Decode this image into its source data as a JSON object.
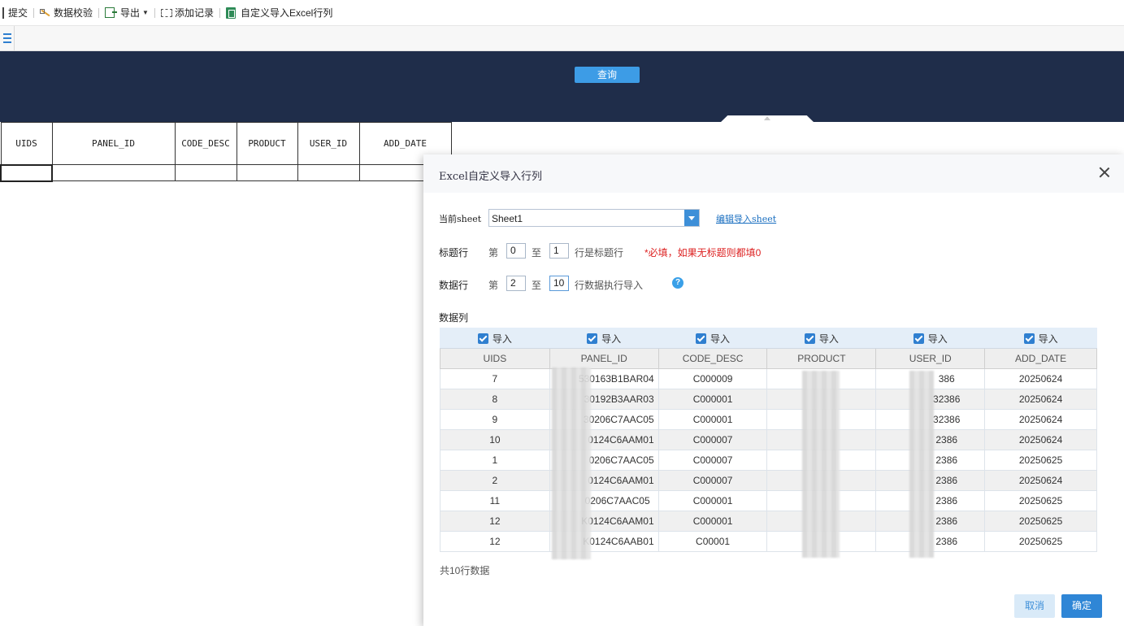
{
  "toolbar": {
    "submit": "提交",
    "validate": "数据校验",
    "export": "导出",
    "add_record": "添加记录",
    "custom_import": "自定义导入Excel行列"
  },
  "query": {
    "button": "查询"
  },
  "sheet": {
    "headers": [
      "UIDS",
      "PANEL_ID",
      "CODE_DESC",
      "PRODUCT",
      "USER_ID",
      "ADD_DATE"
    ]
  },
  "dialog": {
    "title": "Excel自定义导入行列",
    "current_sheet_label": "当前sheet",
    "sheet_value": "Sheet1",
    "edit_link": "编辑导入sheet",
    "title_row_label": "标题行",
    "title_row_from_prefix": "第",
    "title_row_from": "0",
    "title_row_to_prefix": "至",
    "title_row_to": "1",
    "title_row_suffix": "行是标题行",
    "title_row_required": "*必填，如果无标题则都填0",
    "data_row_label": "数据行",
    "data_row_from_prefix": "第",
    "data_row_from": "2",
    "data_row_to_prefix": "至",
    "data_row_to": "10",
    "data_row_suffix": "行数据执行导入",
    "help": "?",
    "data_cols_label": "数据列",
    "import_label": "导入",
    "columns": [
      "UIDS",
      "PANEL_ID",
      "CODE_DESC",
      "PRODUCT",
      "USER_ID",
      "ADD_DATE"
    ],
    "rows": [
      [
        "7",
        "530163B1BAR04",
        "C000009",
        "",
        "386",
        "20250624"
      ],
      [
        "8",
        "30192B3AAR03",
        "C000001",
        "",
        "32386",
        "20250624"
      ],
      [
        "9",
        "30206C7AAC05",
        "C000001",
        "",
        "32386",
        "20250624"
      ],
      [
        "10",
        "0124C6AAM01",
        "C000007",
        "",
        "2386",
        "20250624"
      ],
      [
        "1",
        "0206C7AAC05",
        "C000007",
        "",
        "2386",
        "20250625"
      ],
      [
        "2",
        "0124C6AAM01",
        "C000007",
        "",
        "2386",
        "20250624"
      ],
      [
        "11",
        "0206C7AAC05",
        "C000001",
        "",
        "2386",
        "20250625"
      ],
      [
        "12",
        "K0124C6AAM01",
        "C000001",
        "",
        "2386",
        "20250625"
      ],
      [
        "12",
        "K0124C6AAB01",
        "C00001",
        "",
        "2386",
        "20250625"
      ]
    ],
    "total": "共10行数据",
    "cancel": "取消",
    "ok": "确定"
  }
}
